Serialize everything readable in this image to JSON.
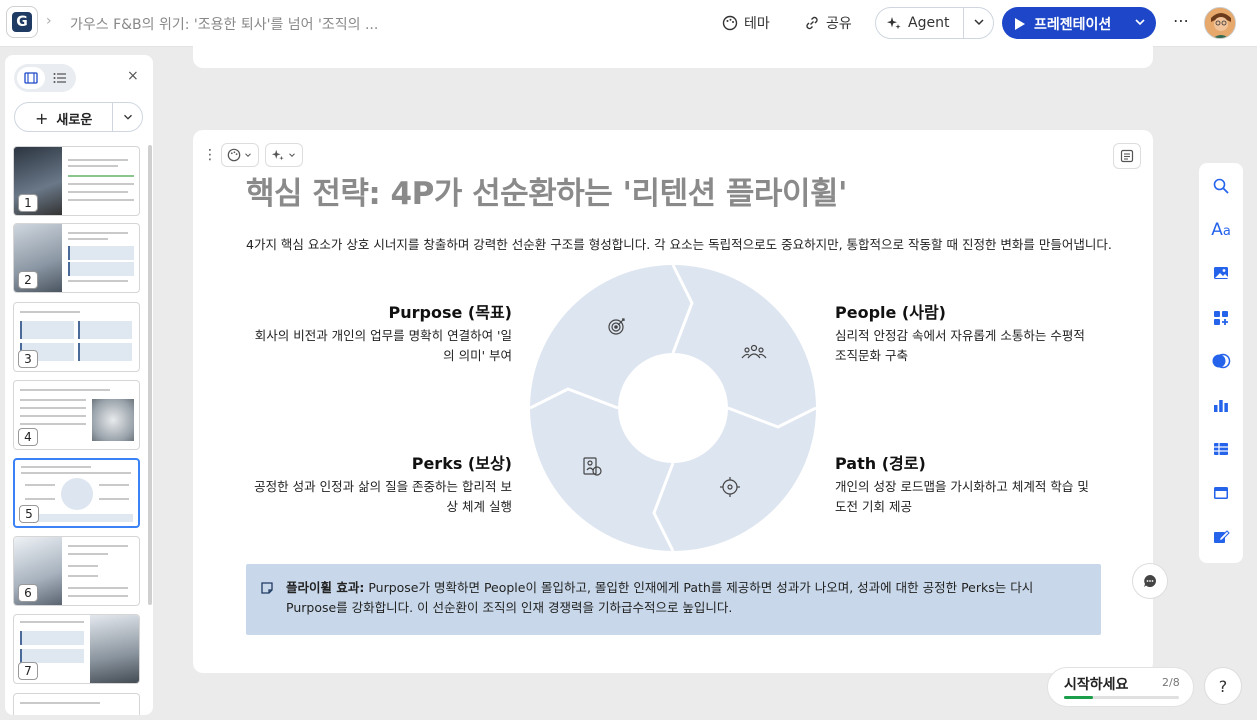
{
  "topbar": {
    "doc_title": "가우스 F&B의 위기: '조용한 퇴사'를 넘어 '조직의 ...",
    "theme_label": "테마",
    "share_label": "공유",
    "agent_label": "Agent",
    "present_label": "프레젠테이션",
    "more_label": "⋯"
  },
  "sidebar": {
    "new_label": "새로운",
    "close_label": "×",
    "thumbnails": [
      {
        "number": "1"
      },
      {
        "number": "2"
      },
      {
        "number": "3"
      },
      {
        "number": "4"
      },
      {
        "number": "5"
      },
      {
        "number": "6"
      },
      {
        "number": "7"
      }
    ]
  },
  "slide": {
    "title": "핵심 전략: 4P가 선순환하는 '리텐션 플라이휠'",
    "description": "4가지 핵심 요소가 상호 시너지를 창출하며 강력한 선순환 구조를 형성합니다. 각 요소는 독립적으로도 중요하지만, 통합적으로 작동할 때 진정한 변화를 만들어냅니다.",
    "purpose": {
      "title": "Purpose (목표)",
      "desc": "회사의 비전과 개인의 업무를 명확히 연결하여 '일의 의미' 부여"
    },
    "people": {
      "title": "People (사람)",
      "desc": "심리적 안정감 속에서 자유롭게 소통하는 수평적 조직문화 구축"
    },
    "perks": {
      "title": "Perks (보상)",
      "desc": "공정한 성과 인정과 삶의 질을 존중하는 합리적 보상 체계 실행"
    },
    "path": {
      "title": "Path (경로)",
      "desc": "개인의 성장 로드맵을 가시화하고 체계적 학습 및 도전 기회 제공"
    },
    "callout_bold": "플라이휠 효과:",
    "callout_text": " Purpose가 명확하면 People이 몰입하고, 몰입한 인재에게 Path를 제공하면 성과가 나오며, 성과에 대한 공정한 Perks는 다시 Purpose를 강화합니다. 이 선순환이 조직의 인재 경쟁력을 기하급수적으로 높입니다."
  },
  "bottom": {
    "start_label": "시작하세요",
    "start_count": "2/8",
    "start_progress": 0.25,
    "help_label": "?"
  },
  "colors": {
    "accent": "#1d47c8",
    "wheel_fill": "#dde5f0",
    "callout_bg": "#c8d8ea",
    "progress": "#1a9e4a"
  }
}
